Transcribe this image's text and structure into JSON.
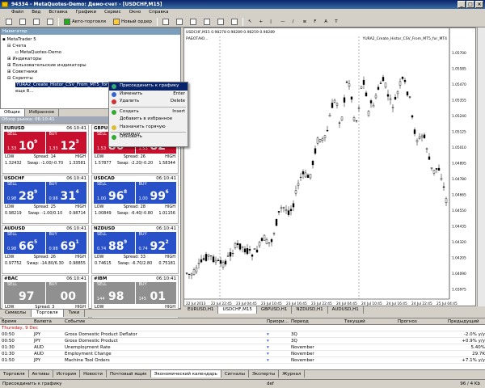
{
  "window": {
    "title": "94334 - MetaQuotes-Demo: Демо-счет - [USDCHF,M15]"
  },
  "menu": [
    "Файл",
    "Вид",
    "Вставка",
    "Графики",
    "Сервис",
    "Окно",
    "Справка"
  ],
  "toolbar": {
    "autotrade": "Авто-торговля",
    "new_order": "Новый ордер"
  },
  "navigator": {
    "header": "Навигатор",
    "items": [
      "MetaTrader 5",
      "Счета",
      "MetaQuotes-Demo",
      "Индикаторы",
      "Пользовательские индикаторы",
      "Советники",
      "Скрипты",
      "YURA2_Create_Histor_CSV_From_MT5_for_",
      "еще 8..."
    ],
    "tabs": [
      "Общие",
      "Избранное"
    ]
  },
  "context_menu": [
    {
      "label": "Присоединить к графику",
      "key": ""
    },
    {
      "label": "Изменить",
      "key": "Enter"
    },
    {
      "label": "Удалить",
      "key": "Delete"
    },
    {
      "label": "Создать",
      "key": "Insert"
    },
    {
      "label": "Добавить в избранное",
      "key": ""
    },
    {
      "label": "Назначить горячую клавишу",
      "key": ""
    },
    {
      "label": "Обновить",
      "key": ""
    }
  ],
  "market_watch": {
    "header": "Обзор рынка: 06:10:41",
    "labels": {
      "sell": "SELL",
      "buy": "BUY",
      "low": "LOW",
      "high": "HIGH",
      "spread": "Spread:",
      "swap": "Swap:"
    },
    "tiles": [
      {
        "symbol": "EURUSD",
        "time": "06:10:41",
        "bid_small": "1.33",
        "bid_big": "10",
        "bid_sup": "9",
        "ask_small": "1.33",
        "ask_big": "12",
        "ask_sup": "3",
        "low": "1.32432",
        "high": "1.33581",
        "spread": "14",
        "swap": "-1.00/-0.70",
        "color": "#c8102e"
      },
      {
        "symbol": "GBPUSD",
        "time": "06:10:41",
        "bid_small": "1.53",
        "bid_big": "80",
        "bid_sup": "0",
        "ask_small": "1.53",
        "ask_big": "82",
        "ask_sup": "6",
        "low": "1.57877",
        "high": "1.58344",
        "spread": "26",
        "swap": "-2.20/-0.20",
        "color": "#c8102e"
      },
      {
        "symbol": "USDCHF",
        "time": "06:10:41",
        "bid_small": "0.98",
        "bid_big": "28",
        "bid_sup": "9",
        "ask_small": "0.98",
        "ask_big": "31",
        "ask_sup": "4",
        "low": "0.98219",
        "high": "0.98714",
        "spread": "25",
        "swap": "-1.00/0.10",
        "color": "#2850c8"
      },
      {
        "symbol": "USDCAD",
        "time": "06:10:41",
        "bid_small": "1.00",
        "bid_big": "96",
        "bid_sup": "8",
        "ask_small": "1.00",
        "ask_big": "99",
        "ask_sup": "6",
        "low": "1.00849",
        "high": "1.01156",
        "spread": "28",
        "swap": "-6.40/-0.80",
        "color": "#2850c8"
      },
      {
        "symbol": "AUDUSD",
        "time": "06:10:41",
        "bid_small": "0.98",
        "bid_big": "66",
        "bid_sup": "5",
        "ask_small": "0.98",
        "ask_big": "69",
        "ask_sup": "1",
        "low": "0.97752",
        "high": "0.98855",
        "spread": "26",
        "swap": "-14.80/6.30",
        "color": "#2850c8"
      },
      {
        "symbol": "NZDUSD",
        "time": "06:10:41",
        "bid_small": "0.74",
        "bid_big": "88",
        "bid_sup": "9",
        "ask_small": "0.74",
        "ask_big": "92",
        "ask_sup": "2",
        "low": "0.74615",
        "high": "0.75181",
        "spread": "33",
        "swap": "-6.70/2.80",
        "color": "#2850c8"
      },
      {
        "symbol": "#BAC",
        "time": "06:10:41",
        "bid_small": "",
        "bid_big": "97",
        "bid_sup": "",
        "ask_small": "",
        "ask_big": "00",
        "ask_sup": "",
        "low": "",
        "high": "",
        "spread": "3",
        "swap": "",
        "color": "#909090"
      },
      {
        "symbol": "#IBM",
        "time": "06:10:41",
        "bid_small": "144",
        "bid_big": "98",
        "bid_sup": "",
        "ask_small": "145",
        "ask_big": "01",
        "ask_sup": "",
        "low": "",
        "high": "",
        "spread": "",
        "swap": "",
        "color": "#909090"
      }
    ],
    "tabs": [
      "Символы",
      "Торговля",
      "Тики"
    ]
  },
  "chart": {
    "symbol_line": "USDCHF,M15  0.98278 0.98289 0.98259 0.98289",
    "work_label": "РАБОТАЮ...",
    "script_label": "YURA2_Create_Histor_CSV_From_MT5_for_MT4",
    "price_ticks": [
      "1.05700",
      "1.05585",
      "1.05470",
      "1.05355",
      "1.05240",
      "1.05125",
      "1.05010",
      "1.04895",
      "1.04780",
      "1.04665",
      "1.04550",
      "1.04435",
      "1.04320",
      "1.04205",
      "1.04090",
      "1.03975"
    ],
    "time_ticks": [
      "22 Jul 2013",
      "22 Jul 22:45",
      "23 Jul 04:45",
      "23 Jul 10:45",
      "23 Jul 16:45",
      "23 Jul 22:45",
      "24 Jul 04:45",
      "24 Jul 10:45",
      "24 Jul 16:45",
      "24 Jul 22:45",
      "25 Jul 04:45"
    ],
    "tabs": [
      "EURUSD,H1",
      "USDCHF,M15",
      "GBPUSD,H1",
      "NZDUSD,H1",
      "AUDUSD,H1"
    ]
  },
  "calendar": {
    "headers": [
      "Время",
      "Валюта",
      "Событие",
      "Приори...",
      "Период",
      "Текущий",
      "Прогноз",
      "Предыдущий"
    ],
    "day": "Thursday, 9 Dec",
    "rows": [
      {
        "time": "00:50",
        "cur": "JPY",
        "event": "Gross Domestic Product Deflator",
        "period": "3Q",
        "current": "",
        "forecast": "",
        "previous": "-2.0% y/y"
      },
      {
        "time": "00:50",
        "cur": "JPY",
        "event": "Gross Domestic Product",
        "period": "3Q",
        "current": "",
        "forecast": "",
        "previous": "+0.9% y/y"
      },
      {
        "time": "01:30",
        "cur": "AUD",
        "event": "Unemployment Rate",
        "period": "November",
        "current": "",
        "forecast": "",
        "previous": "5.40%"
      },
      {
        "time": "01:30",
        "cur": "AUD",
        "event": "Employment Change",
        "period": "November",
        "current": "",
        "forecast": "",
        "previous": "29.7K"
      },
      {
        "time": "01:50",
        "cur": "JPY",
        "event": "Machine Tool Orders",
        "period": "November",
        "current": "",
        "forecast": "",
        "previous": "+7.1% y/y"
      }
    ],
    "tabs": [
      "Торговля",
      "Активы",
      "История",
      "Новости",
      "Почтовый ящик",
      "Экономический календарь",
      "Сигналы",
      "Эксперты",
      "Журнал"
    ]
  },
  "status": {
    "text": "Присоединить к графику",
    "def": "def",
    "traffic": "96 / 4 Kb"
  }
}
